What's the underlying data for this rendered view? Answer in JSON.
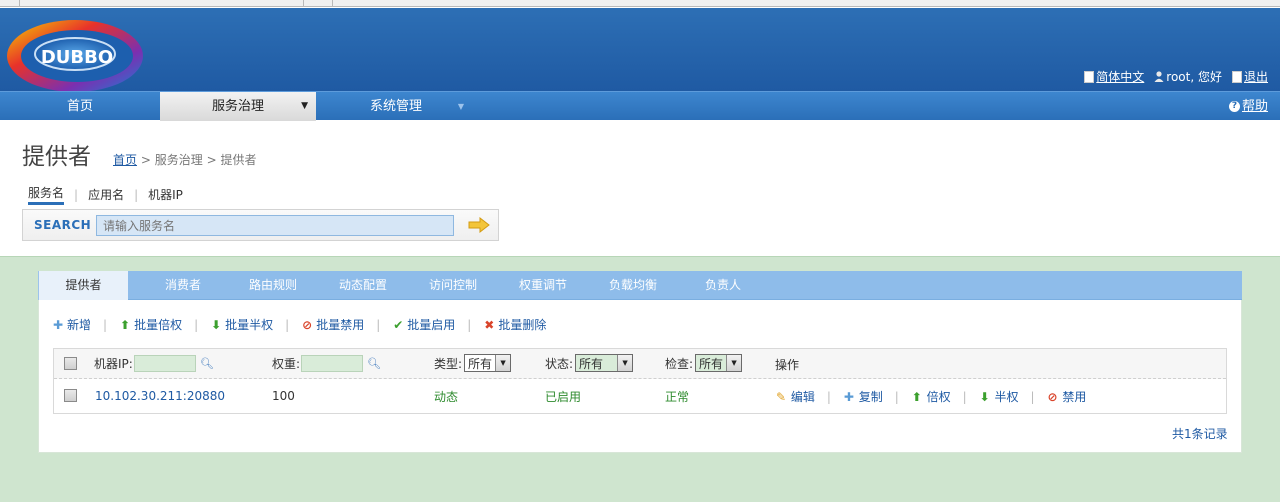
{
  "header": {
    "logo_text": "DUBBO",
    "lang_label": "简体中文",
    "user_greeting": "root, 您好",
    "logout_label": "退出"
  },
  "nav": {
    "home": "首页",
    "service_governance": "服务治理",
    "system_management": "系统管理",
    "help": "帮助"
  },
  "page": {
    "title": "提供者",
    "breadcrumb": {
      "home": "首页",
      "sep1": ">",
      "section": "服务治理",
      "sep2": ">",
      "current": "提供者"
    }
  },
  "search": {
    "tabs": [
      "服务名",
      "应用名",
      "机器IP"
    ],
    "label": "SEARCH",
    "placeholder": "请输入服务名"
  },
  "panel_tabs": [
    "提供者",
    "消费者",
    "路由规则",
    "动态配置",
    "访问控制",
    "权重调节",
    "负载均衡",
    "负责人"
  ],
  "actions": [
    "新增",
    "批量倍权",
    "批量半权",
    "批量禁用",
    "批量启用",
    "批量删除"
  ],
  "table": {
    "headers": {
      "ip": "机器IP:",
      "weight": "权重:",
      "type": "类型:",
      "status": "状态:",
      "check": "检查:",
      "ops": "操作"
    },
    "filter_selects": {
      "type": "所有",
      "status": "所有",
      "check": "所有"
    },
    "rows": [
      {
        "ip": "10.102.30.211:20880",
        "weight": "100",
        "type": "动态",
        "status": "已启用",
        "check": "正常",
        "ops": [
          "编辑",
          "复制",
          "倍权",
          "半权",
          "禁用"
        ]
      }
    ]
  },
  "footer": {
    "total": "共1条记录"
  },
  "colors": {
    "header_blue": "#1f5aa3",
    "nav_blue": "#2b6fb8",
    "content_green": "#cfe5cf",
    "tabbar_blue": "#8ebcea",
    "link_blue": "#1f5aa3",
    "status_green": "#2e8b2e"
  }
}
